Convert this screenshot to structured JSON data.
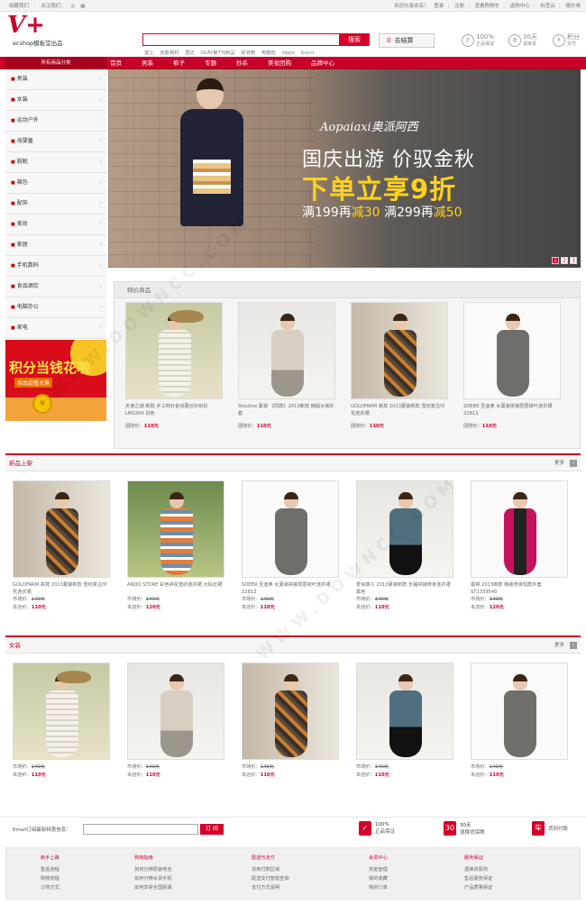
{
  "topbar": {
    "left": [
      "收藏我们",
      "关注我们：",
      "微博",
      "二维码"
    ],
    "right": [
      "欢迎光临本店！",
      "登录",
      "注册",
      "查看购物车",
      "选购中心",
      "标签云",
      "报价单"
    ]
  },
  "header": {
    "logo": "V+",
    "logo_sub": "ecshop模板堂出品",
    "search_button": "搜索",
    "hot_words": [
      "富士",
      "佳能相机",
      "雷达",
      "OLAY第7代新品",
      "耐克鞋",
      "电脑包",
      "zippo",
      "Gucci"
    ],
    "cart_label": "去结算",
    "cart_count": "0",
    "services": [
      {
        "badge": "正",
        "big": "100%",
        "small": "正品保证"
      },
      {
        "badge": "退",
        "big": "30天",
        "small": "退换货"
      },
      {
        "badge": "¥",
        "big": "积分",
        "small": "支付"
      }
    ]
  },
  "nav": {
    "category_title": "所有商品分类",
    "items": [
      "首页",
      "男装",
      "裤子",
      "专题",
      "秒杀",
      "美妆团购",
      "品牌中心"
    ]
  },
  "sidebar": {
    "categories": [
      "男装",
      "女装",
      "运动户外",
      "母婴童",
      "鞋靴",
      "箱包",
      "配饰",
      "美妆",
      "家居",
      "手机数码",
      "食品酒饮",
      "电脑办公",
      "家电"
    ]
  },
  "promo": {
    "title": "积分当钱花啦",
    "subtitle": "商品超值兑换"
  },
  "banner": {
    "brand": "Aopaiaxi奥派阿西",
    "line1": "国庆出游 价驭金秋",
    "line2": "下单立享9折",
    "line3_a": "满199再",
    "line3_b": "减30",
    "line3_c": " 满299再",
    "line3_d": "减50",
    "pages": [
      "1",
      "2",
      "3"
    ]
  },
  "special": {
    "title": "特价商品",
    "products": [
      {
        "name": "天使之城 新款 手工钩针金线蕾丝针织衫LMS304 白色",
        "price_label": "团购价：",
        "price": "110元"
      },
      {
        "name": "Stouline 夏装 《同款》2013新款 韩版女装外套",
        "price_label": "团购价：",
        "price": "110元"
      },
      {
        "name": "GOLDFARM 高梵 2013夏装新款 雪纺复古印花连衣裙",
        "price_label": "团购价：",
        "price": "110元"
      },
      {
        "name": "SDEER 圣迪奥 女夏装拼接层层荷叶连衣裙 22812",
        "price_label": "团购价：",
        "price": "110元"
      }
    ]
  },
  "new_arrivals": {
    "title": "新品上架",
    "more": "更多",
    "products": [
      {
        "name": "GOLDFARM 高梵 2013夏装新款 雪纺复古印花连衣裙",
        "market_label": "市场价：",
        "market": "140元",
        "shop_label": "本店价：",
        "shop": "110元"
      },
      {
        "name": "ANDO STORE 彩色碎花雪纺连衣裙 大码长裙",
        "market_label": "市场价：",
        "market": "140元",
        "shop_label": "本店价：",
        "shop": "120元"
      },
      {
        "name": "SDEER 圣迪奥 女夏装拼接层层荷叶连衣裙 22812",
        "market_label": "市场价：",
        "market": "140元",
        "shop_label": "本店价：",
        "shop": "110元"
      },
      {
        "name": "爱尚丽人 2013夏装新款 长袖拼接修身连衣裙 黑色",
        "market_label": "市场价：",
        "market": "140元",
        "shop_label": "本店价：",
        "shop": "110元"
      },
      {
        "name": "桑顿 2013新款 韩版修身短款外套 ST1339540",
        "market_label": "市场价：",
        "market": "140元",
        "shop_label": "本店价：",
        "shop": "120元"
      }
    ]
  },
  "women": {
    "title": "女装",
    "more": "更多",
    "products": [
      {
        "name": "",
        "market_label": "市场价：",
        "market": "140元",
        "shop_label": "本店价：",
        "shop": "110元"
      },
      {
        "name": "",
        "market_label": "市场价：",
        "market": "140元",
        "shop_label": "本店价：",
        "shop": "110元"
      },
      {
        "name": "",
        "market_label": "市场价：",
        "market": "140元",
        "shop_label": "本店价：",
        "shop": "110元"
      },
      {
        "name": "",
        "market_label": "市场价：",
        "market": "140元",
        "shop_label": "本店价：",
        "shop": "110元"
      },
      {
        "name": "",
        "market_label": "市场价：",
        "market": "140元",
        "shop_label": "本店价：",
        "shop": "110元"
      }
    ]
  },
  "subscribe": {
    "label": "Email订阅最新特惠信息：",
    "button": "订 阅",
    "guarantees": [
      {
        "icon": "✓",
        "big": "100%",
        "small": "正品保证"
      },
      {
        "icon": "30",
        "big": "30天",
        "small": "退换货保障"
      },
      {
        "icon": "车",
        "big": "",
        "small": "货到付款"
      }
    ]
  },
  "footer": {
    "columns": [
      {
        "title": "新手上路",
        "items": [
          "售后流程",
          "购物流程",
          "订购方式"
        ]
      },
      {
        "title": "购物指南",
        "items": [
          "如何分辨原装电池",
          "如何分辨水货手机",
          "如何享受全国联保"
        ]
      },
      {
        "title": "配送与支付",
        "items": [
          "货到付款区域",
          "配送支付智能查询",
          "支付方式说明"
        ]
      },
      {
        "title": "会员中心",
        "items": [
          "资金管理",
          "我的收藏",
          "我的订单"
        ]
      },
      {
        "title": "服务保证",
        "items": [
          "退换货原则",
          "售后服务保证",
          "产品质量保证"
        ]
      }
    ]
  },
  "watermark": "WWW.DOWNCC.COM"
}
